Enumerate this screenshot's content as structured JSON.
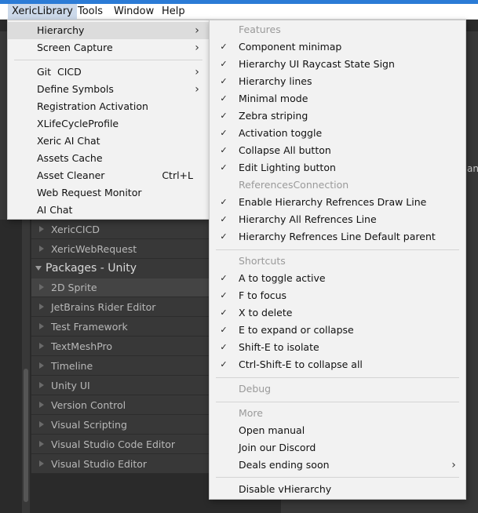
{
  "menubar": {
    "items": [
      "XericLibrary",
      "Tools",
      "Window",
      "Help"
    ]
  },
  "main_menu": {
    "items": [
      {
        "label": "Hierarchy",
        "submenu": true
      },
      {
        "label": "Screen Capture",
        "submenu": true
      },
      {
        "label": "Git  CICD",
        "submenu": true
      },
      {
        "label": "Define Symbols",
        "submenu": true
      },
      {
        "label": "Registration Activation"
      },
      {
        "label": "XLifeCycleProfile"
      },
      {
        "label": "Xeric AI Chat"
      },
      {
        "label": "Assets Cache"
      },
      {
        "label": "Asset Cleaner",
        "shortcut": "Ctrl+L"
      },
      {
        "label": "Web Request Monitor"
      },
      {
        "label": "AI Chat"
      }
    ]
  },
  "hierarchy_submenu": {
    "features_header": "Features",
    "features": [
      "Component minimap",
      "Hierarchy UI Raycast State Sign",
      "Hierarchy lines",
      "Minimal mode",
      "Zebra striping",
      "Activation toggle",
      "Collapse All button",
      "Edit Lighting button"
    ],
    "references_header": "ReferencesConnection",
    "references": [
      "Enable Hierarchy Refrences Draw Line",
      "Hierarchy All Refrences Line",
      "Hierarchy Refrences Line Default parent"
    ],
    "shortcuts_header": "Shortcuts",
    "shortcuts": [
      "A to toggle active",
      "F to focus",
      "X to delete",
      "E to expand or collapse",
      "Shift-E to isolate",
      "Ctrl-Shift-E to collapse all"
    ],
    "debug_header": "Debug",
    "more_header": "More",
    "more": [
      "Open manual",
      "Join our Discord",
      "Deals ending soon"
    ],
    "disable": "Disable vHierarchy",
    "check_glyph": "✓",
    "arrow_glyph": "›"
  },
  "packages": {
    "top_rows": [
      "XericCICD",
      "XericWebRequest"
    ],
    "header": "Packages - Unity",
    "rows": [
      "2D Sprite",
      "JetBrains Rider Editor",
      "Test Framework",
      "TextMeshPro",
      "Timeline",
      "Unity UI",
      "Version Control",
      "Visual Scripting",
      "Visual Studio Code Editor",
      "Visual Studio Editor"
    ]
  },
  "right_panel": {
    "partial_text": "an"
  },
  "colors": {
    "accent": "#2b7bd6",
    "menu_bg": "#f2f2f2",
    "editor_bg": "#2a2a2a"
  }
}
